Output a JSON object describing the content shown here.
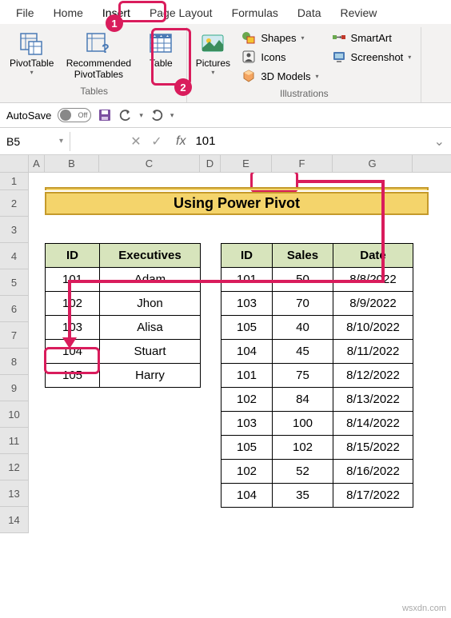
{
  "ribbon_tabs": [
    "File",
    "Home",
    "Insert",
    "Page Layout",
    "Formulas",
    "Data",
    "Review"
  ],
  "active_tab": "Insert",
  "tables_group": {
    "label": "Tables",
    "pivottable": "PivotTable",
    "recommended": "Recommended\nPivotTables",
    "table": "Table"
  },
  "illustrations_group": {
    "label": "Illustrations",
    "pictures": "Pictures",
    "shapes": "Shapes",
    "icons": "Icons",
    "models": "3D Models",
    "smartart": "SmartArt",
    "screenshot": "Screenshot"
  },
  "qat": {
    "autosave": "AutoSave",
    "off": "Off"
  },
  "name_box": "B5",
  "formula_value": "101",
  "columns": [
    "A",
    "B",
    "C",
    "D",
    "E",
    "F",
    "G"
  ],
  "rows": [
    "1",
    "2",
    "3",
    "4",
    "5",
    "6",
    "7",
    "8",
    "9",
    "10",
    "11",
    "12",
    "13",
    "14"
  ],
  "title": "Using Power Pivot",
  "table1": {
    "headers": [
      "ID",
      "Executives"
    ],
    "rows": [
      [
        "101",
        "Adam"
      ],
      [
        "102",
        "Jhon"
      ],
      [
        "103",
        "Alisa"
      ],
      [
        "104",
        "Stuart"
      ],
      [
        "105",
        "Harry"
      ]
    ]
  },
  "table2": {
    "headers": [
      "ID",
      "Sales",
      "Date"
    ],
    "rows": [
      [
        "101",
        "50",
        "8/8/2022"
      ],
      [
        "103",
        "70",
        "8/9/2022"
      ],
      [
        "105",
        "40",
        "8/10/2022"
      ],
      [
        "104",
        "45",
        "8/11/2022"
      ],
      [
        "101",
        "75",
        "8/12/2022"
      ],
      [
        "102",
        "84",
        "8/13/2022"
      ],
      [
        "103",
        "100",
        "8/14/2022"
      ],
      [
        "105",
        "102",
        "8/15/2022"
      ],
      [
        "102",
        "52",
        "8/16/2022"
      ],
      [
        "104",
        "35",
        "8/17/2022"
      ]
    ]
  },
  "callout1": "1",
  "callout2": "2",
  "watermark": "wsxdn.com"
}
